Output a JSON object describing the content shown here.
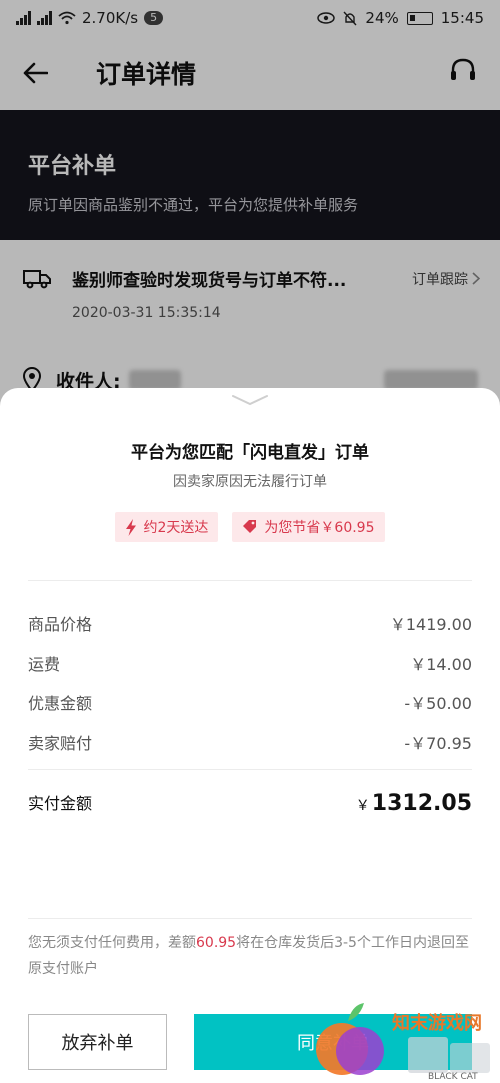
{
  "status_bar": {
    "network_speed": "2.70K/s",
    "notif_count": "5",
    "battery": "24%",
    "time": "15:45"
  },
  "nav": {
    "title": "订单详情"
  },
  "banner": {
    "title": "平台补单",
    "subtitle": "原订单因商品鉴别不通过，平台为您提供补单服务"
  },
  "tracking": {
    "message": "鉴别师查验时发现货号与订单不符...",
    "timestamp": "2020-03-31 15:35:14",
    "link_label": "订单跟踪"
  },
  "address": {
    "recipient_label": "收件人:"
  },
  "sheet": {
    "title": "平台为您匹配「闪电直发」订单",
    "subtitle": "因卖家原因无法履行订单",
    "tags": {
      "delivery": "约2天送达",
      "saving": "为您节省￥60.95"
    },
    "prices": [
      {
        "label": "商品价格",
        "value": "￥1419.00"
      },
      {
        "label": "运费",
        "value": "￥14.00"
      },
      {
        "label": "优惠金额",
        "value": "-￥50.00"
      },
      {
        "label": "卖家赔付",
        "value": "-￥70.95"
      }
    ],
    "total": {
      "label": "实付金额",
      "currency": "￥",
      "amount": "1312.05"
    },
    "note": {
      "part1": "您无须支付任何费用，差额",
      "highlight": "60.95",
      "part2": "将在仓库发货后3-5个工作日内退回至原支付账户"
    },
    "buttons": {
      "give_up": "放弃补单",
      "agree": "同意补单"
    }
  },
  "watermark": {
    "text": "知末游戏网",
    "sub": "BLACK CAT"
  },
  "colors": {
    "accent": "#01c2c3",
    "highlight": "#d8394d",
    "banner_bg": "#16161e"
  }
}
